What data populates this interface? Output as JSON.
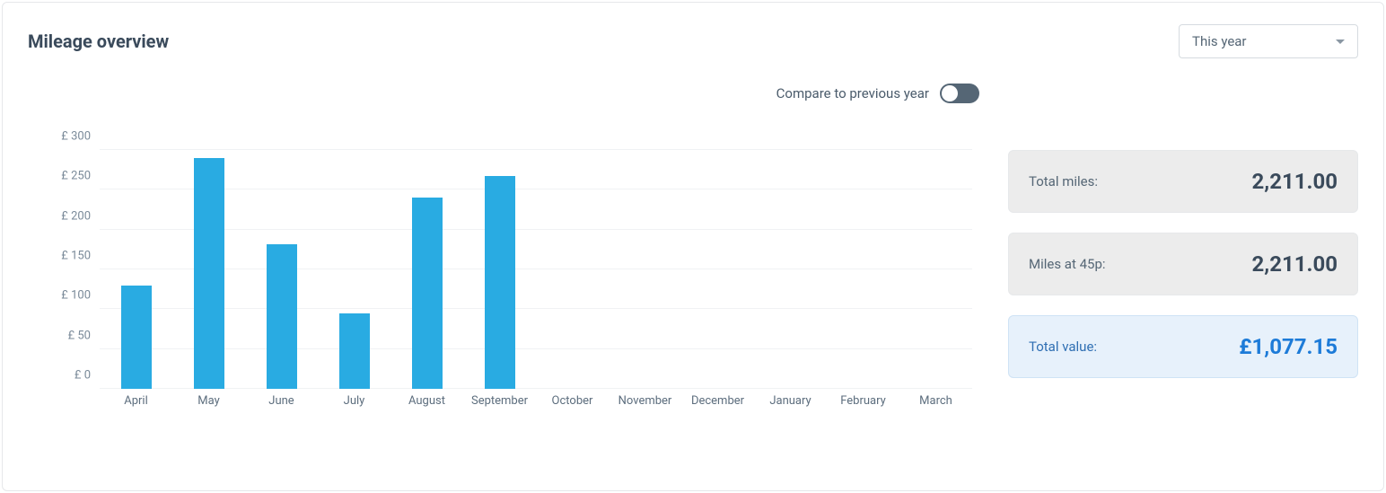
{
  "title": "Mileage overview",
  "dropdown": {
    "selected": "This year"
  },
  "compare": {
    "label": "Compare to previous year",
    "on": false
  },
  "stats": [
    {
      "label": "Total miles:",
      "value": "2,211.00",
      "highlight": false
    },
    {
      "label": "Miles at 45p:",
      "value": "2,211.00",
      "highlight": false
    },
    {
      "label": "Total value:",
      "value": "£1,077.15",
      "highlight": true
    }
  ],
  "chart_data": {
    "type": "bar",
    "categories": [
      "April",
      "May",
      "June",
      "July",
      "August",
      "September",
      "October",
      "November",
      "December",
      "January",
      "February",
      "March"
    ],
    "values": [
      130,
      290,
      182,
      95,
      240,
      267,
      0,
      0,
      0,
      0,
      0,
      0
    ],
    "title": "",
    "xlabel": "",
    "ylabel": "",
    "ylim": [
      0,
      300
    ],
    "yticks": [
      0,
      50,
      100,
      150,
      200,
      250,
      300
    ],
    "ytick_labels": [
      "£ 0",
      "£ 50",
      "£ 100",
      "£ 150",
      "£ 200",
      "£ 250",
      "£ 300"
    ]
  }
}
